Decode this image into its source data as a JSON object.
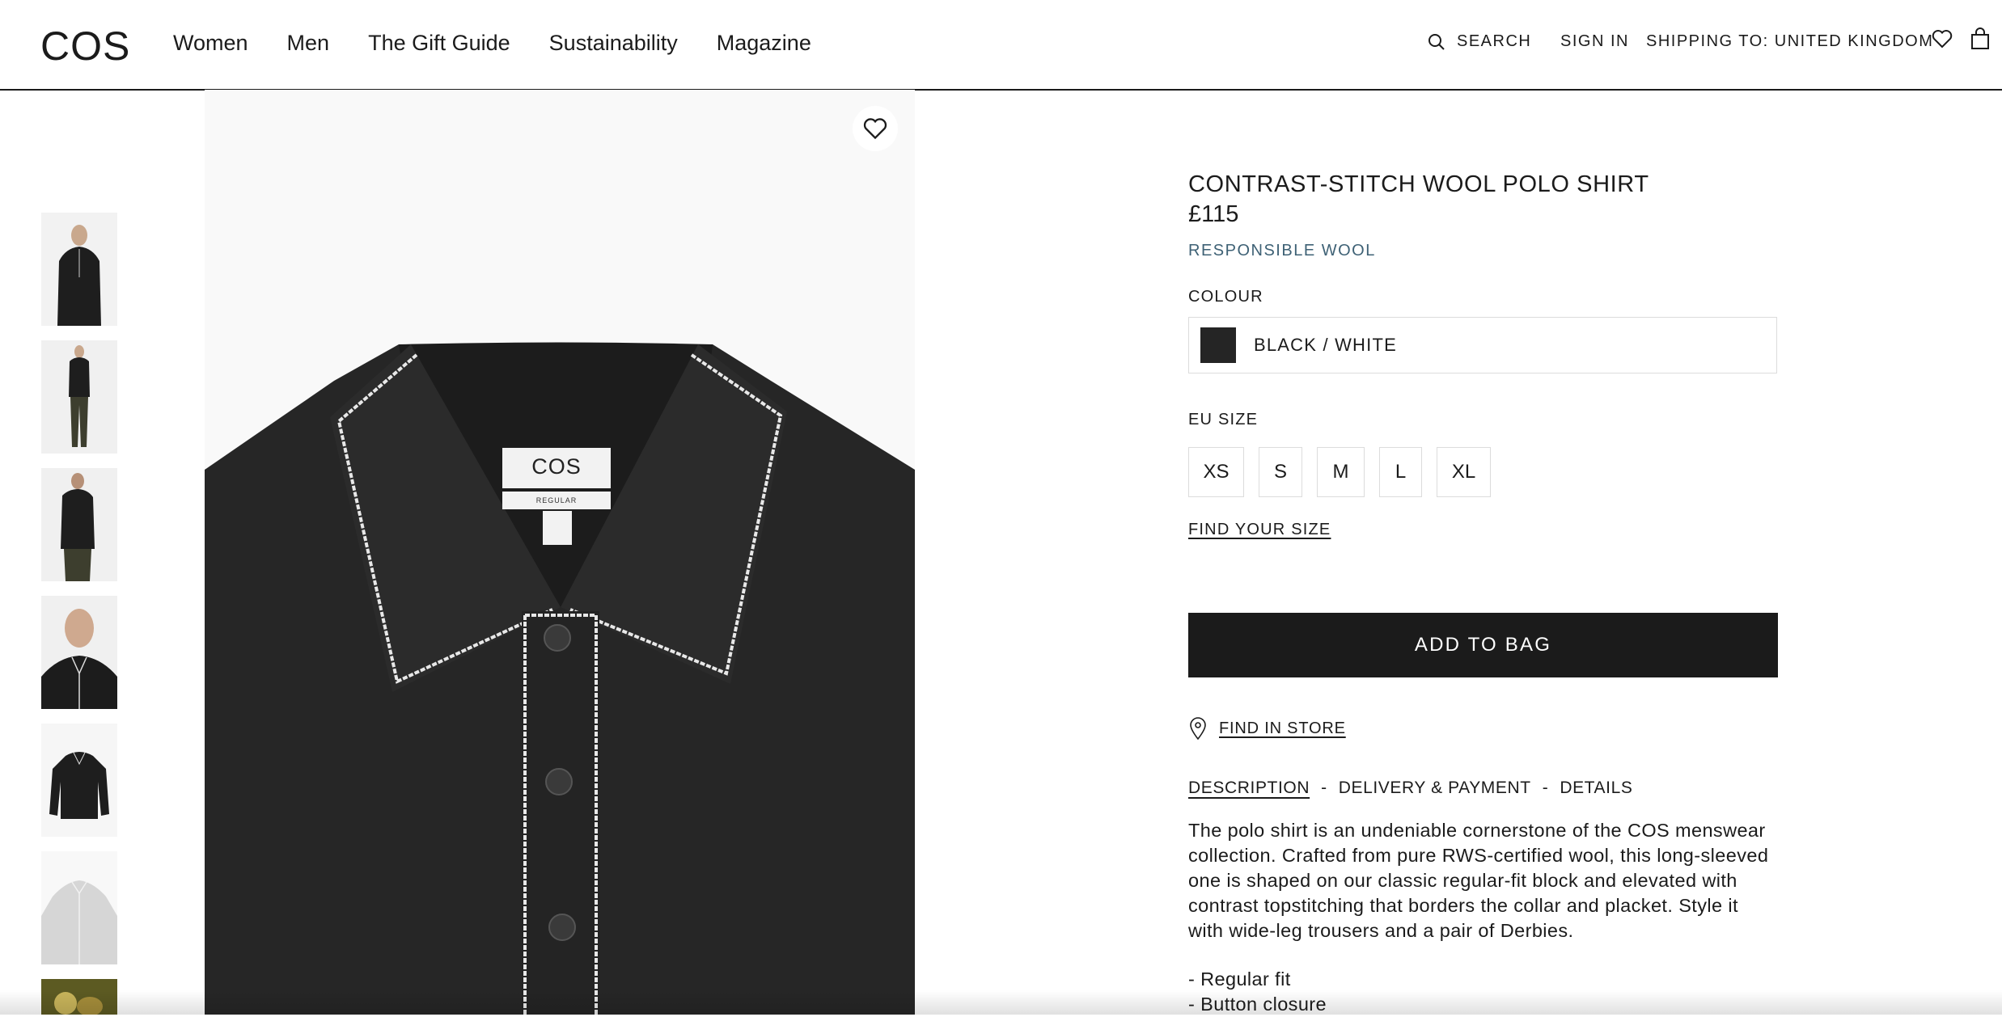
{
  "header": {
    "logo": "COS",
    "nav": [
      "Women",
      "Men",
      "The Gift Guide",
      "Sustainability",
      "Magazine"
    ],
    "search_label": "SEARCH",
    "signin_label": "SIGN IN",
    "shipping_label": "SHIPPING TO: UNITED KINGDOM"
  },
  "product": {
    "title": "CONTRAST-STITCH WOOL POLO SHIRT",
    "price": "£115",
    "tag": "RESPONSIBLE WOOL",
    "colour_label": "COLOUR",
    "colour_value": "BLACK / WHITE",
    "size_label": "EU SIZE",
    "sizes": [
      "XS",
      "S",
      "M",
      "L",
      "XL"
    ],
    "find_size": "FIND YOUR SIZE",
    "add_to_bag": "ADD TO BAG",
    "find_in_store": "FIND IN STORE",
    "tabs": [
      "DESCRIPTION",
      "DELIVERY & PAYMENT",
      "DETAILS"
    ],
    "tab_separator": "-",
    "description": "The polo shirt is an undeniable cornerstone of the COS menswear collection. Crafted from pure RWS-certified wool, this long-sleeved one is shaped on our classic regular-fit block and elevated with contrast topstitching that borders the collar and placket. Style it with wide-leg trousers and a pair of Derbies.",
    "bullets": [
      "- Regular fit",
      "- Button closure"
    ]
  },
  "image": {
    "label_brand": "COS",
    "label_fit": "REGULAR"
  },
  "colors": {
    "text": "#1b1b1b",
    "accent_blue": "#3e6175",
    "button_bg": "#1b1b1b",
    "border": "#dcdcdc"
  }
}
